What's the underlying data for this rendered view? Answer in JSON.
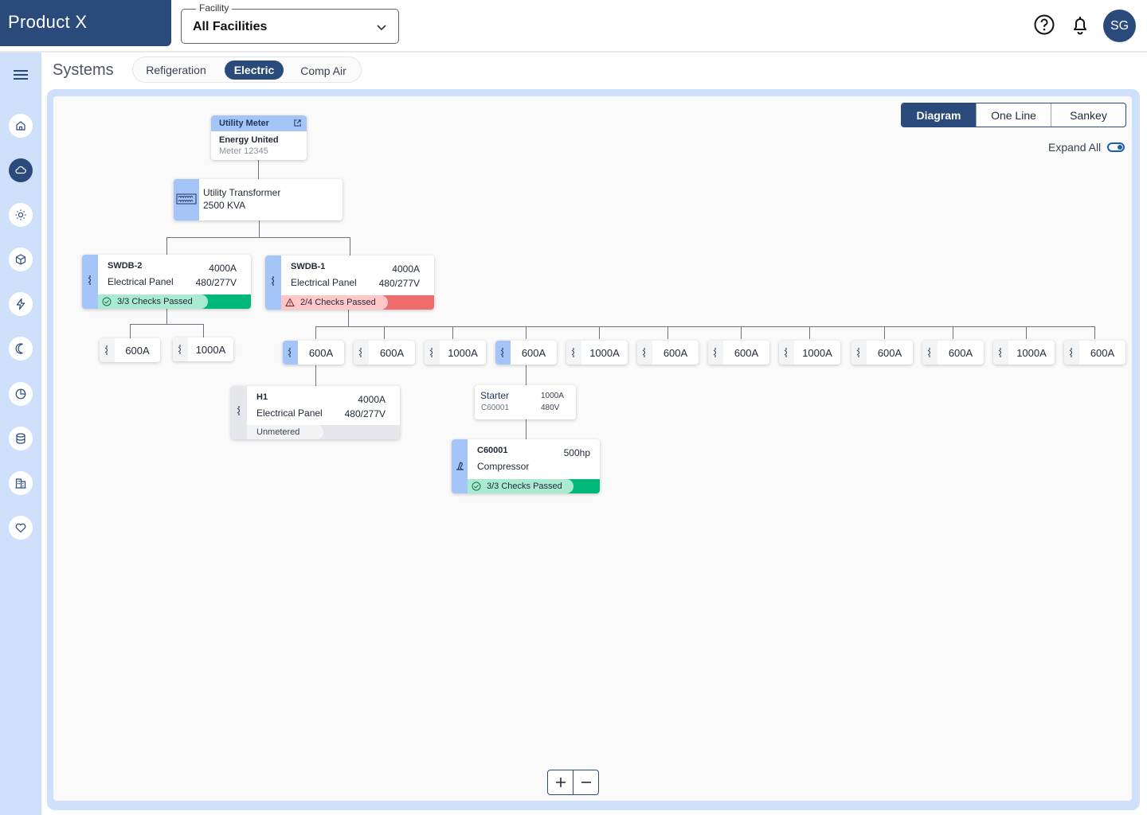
{
  "app": {
    "brand": "Product X"
  },
  "facility": {
    "label": "Facility",
    "value": "All Facilities"
  },
  "user": {
    "initials": "SG"
  },
  "page": {
    "title": "Systems"
  },
  "tabs": [
    {
      "label": "Refigeration",
      "active": false
    },
    {
      "label": "Electric",
      "active": true
    },
    {
      "label": "Comp Air",
      "active": false
    }
  ],
  "views": [
    {
      "label": "Diagram",
      "active": true
    },
    {
      "label": "One Line",
      "active": false
    },
    {
      "label": "Sankey",
      "active": false
    }
  ],
  "expand_all": {
    "label": "Expand All",
    "on": true
  },
  "colors": {
    "brand": "#2a4a7c",
    "sidebar": "#cfe0fb",
    "accent_strip": "#a5c4f7",
    "pass": "#00b87a",
    "fail": "#f06c6c"
  },
  "sidebar_icons": [
    "menu-icon",
    "home-icon",
    "cloud-icon",
    "sun-icon",
    "cube-icon",
    "bolt-icon",
    "moon-icon",
    "pie-chart-icon",
    "database-icon",
    "building-icon",
    "heart-icon"
  ],
  "diagram": {
    "utility_meter": {
      "header": "Utility Meter",
      "name": "Energy United",
      "id": "Meter 12345"
    },
    "transformer": {
      "name": "Utility Transformer",
      "rating": "2500 KVA"
    },
    "swdb2": {
      "name": "SWDB-2",
      "type": "Electrical Panel",
      "amps": "4000A",
      "volts": "480/277V",
      "status": "3/3 Checks Passed",
      "pass_fraction": 0.72
    },
    "swdb1": {
      "name": "SWDB-1",
      "type": "Electrical Panel",
      "amps": "4000A",
      "volts": "480/277V",
      "status": "2/4 Checks Passed",
      "pass_fraction": 0.7
    },
    "swdb2_breakers": [
      "600A",
      "1000A"
    ],
    "swdb1_breakers": [
      "600A",
      "600A",
      "1000A",
      "600A",
      "1000A",
      "600A",
      "600A",
      "1000A",
      "600A",
      "600A",
      "1000A",
      "600A"
    ],
    "h1": {
      "name": "H1",
      "type": "Electrical Panel",
      "amps": "4000A",
      "volts": "480/277V",
      "status": "Unmetered",
      "pass_fraction": 0.5
    },
    "starter": {
      "name": "Starter",
      "id": "C60001",
      "amps": "1000A",
      "volts": "480V"
    },
    "compressor": {
      "name": "C60001",
      "type": "Compressor",
      "power": "500hp",
      "status": "3/3 Checks Passed",
      "pass_fraction": 0.8
    }
  },
  "zoom": {
    "in": "+",
    "out": "−"
  }
}
